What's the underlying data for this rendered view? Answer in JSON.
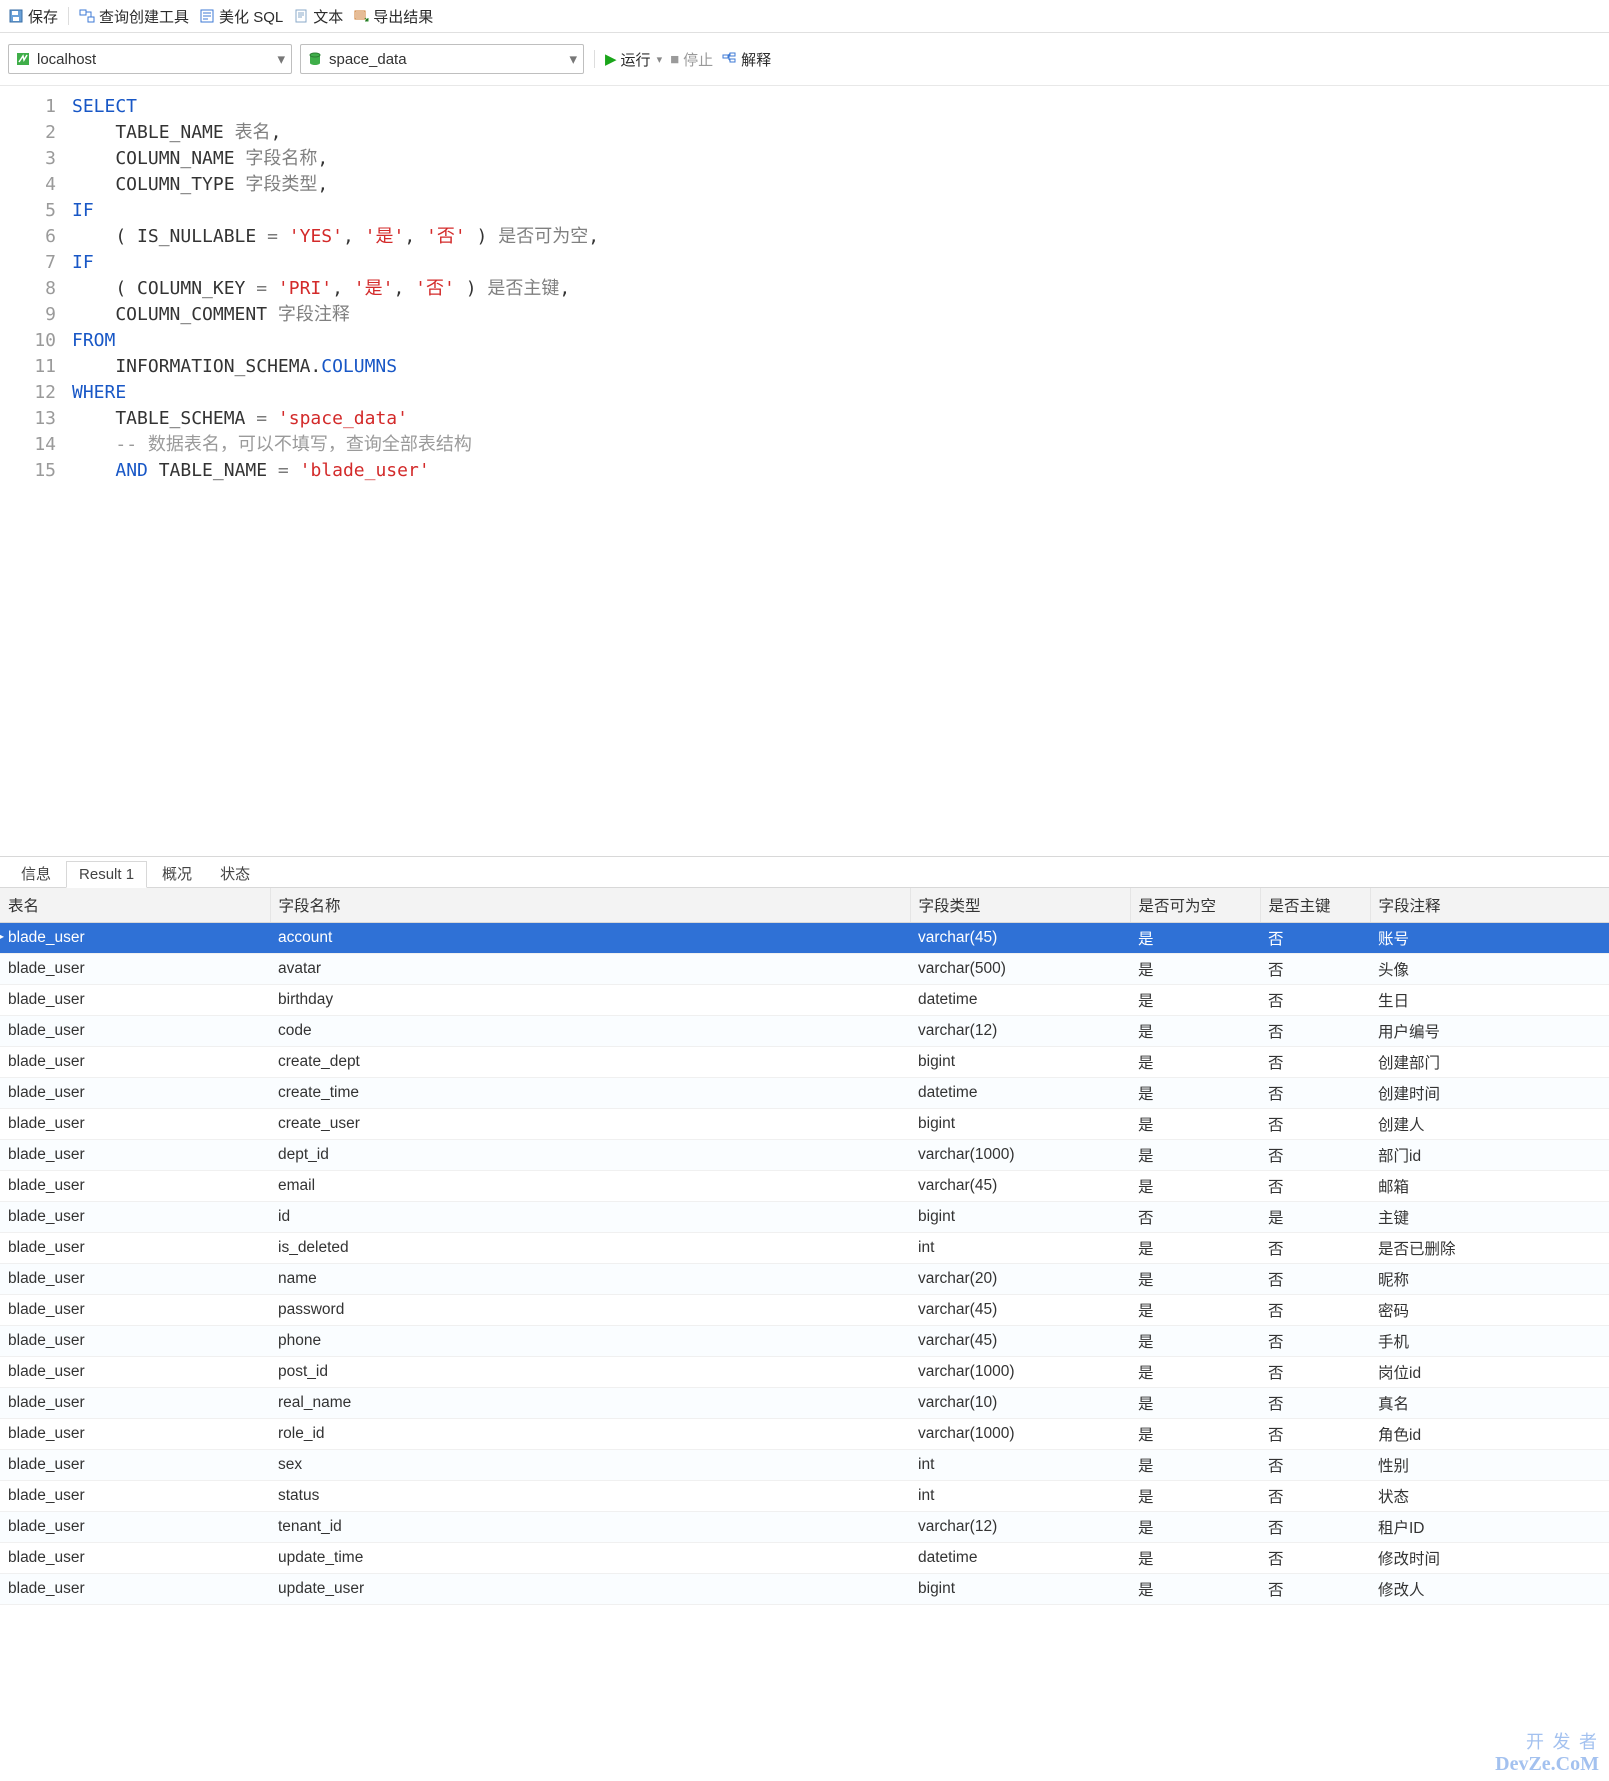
{
  "toolbar": {
    "save": "保存",
    "query_builder": "查询创建工具",
    "beautify": "美化 SQL",
    "text": "文本",
    "export": "导出结果"
  },
  "runbar": {
    "connection": "localhost",
    "database": "space_data",
    "run": "运行",
    "stop": "停止",
    "explain": "解释"
  },
  "code_lines": [
    [
      {
        "t": "SELECT",
        "c": "kw"
      }
    ],
    [
      {
        "t": "    TABLE_NAME "
      },
      {
        "t": "表名",
        "c": "cjk"
      },
      {
        "t": ","
      }
    ],
    [
      {
        "t": "    COLUMN_NAME "
      },
      {
        "t": "字段名称",
        "c": "cjk"
      },
      {
        "t": ","
      }
    ],
    [
      {
        "t": "    COLUMN_TYPE "
      },
      {
        "t": "字段类型",
        "c": "cjk"
      },
      {
        "t": ","
      }
    ],
    [
      {
        "t": "IF",
        "c": "kw"
      }
    ],
    [
      {
        "t": "    ( IS_NULLABLE "
      },
      {
        "t": "=",
        "c": "op"
      },
      {
        "t": " "
      },
      {
        "t": "'YES'",
        "c": "str"
      },
      {
        "t": ", "
      },
      {
        "t": "'是'",
        "c": "str"
      },
      {
        "t": ", "
      },
      {
        "t": "'否'",
        "c": "str"
      },
      {
        "t": " ) "
      },
      {
        "t": "是否可为空",
        "c": "cjk"
      },
      {
        "t": ","
      }
    ],
    [
      {
        "t": "IF",
        "c": "kw"
      }
    ],
    [
      {
        "t": "    ( COLUMN_KEY "
      },
      {
        "t": "=",
        "c": "op"
      },
      {
        "t": " "
      },
      {
        "t": "'PRI'",
        "c": "str"
      },
      {
        "t": ", "
      },
      {
        "t": "'是'",
        "c": "str"
      },
      {
        "t": ", "
      },
      {
        "t": "'否'",
        "c": "str"
      },
      {
        "t": " ) "
      },
      {
        "t": "是否主键",
        "c": "cjk"
      },
      {
        "t": ","
      }
    ],
    [
      {
        "t": "    COLUMN_COMMENT "
      },
      {
        "t": "字段注释",
        "c": "cjk"
      }
    ],
    [
      {
        "t": "FROM",
        "c": "kw"
      }
    ],
    [
      {
        "t": "    INFORMATION_SCHEMA."
      },
      {
        "t": "COLUMNS",
        "c": "col"
      }
    ],
    [
      {
        "t": "WHERE",
        "c": "kw"
      }
    ],
    [
      {
        "t": "    TABLE_SCHEMA "
      },
      {
        "t": "=",
        "c": "op"
      },
      {
        "t": " "
      },
      {
        "t": "'space_data'",
        "c": "str"
      }
    ],
    [
      {
        "t": "    "
      },
      {
        "t": "-- 数据表名，可以不填写，查询全部表结构",
        "c": "cmt"
      }
    ],
    [
      {
        "t": "    "
      },
      {
        "t": "AND",
        "c": "kw"
      },
      {
        "t": " TABLE_NAME "
      },
      {
        "t": "=",
        "c": "op"
      },
      {
        "t": " "
      },
      {
        "t": "'blade_user'",
        "c": "str"
      }
    ]
  ],
  "result_tabs": {
    "info": "信息",
    "result1": "Result 1",
    "profile": "概况",
    "status": "状态"
  },
  "columns": [
    "表名",
    "字段名称",
    "字段类型",
    "是否可为空",
    "是否主键",
    "字段注释"
  ],
  "rows": [
    [
      "blade_user",
      "account",
      "varchar(45)",
      "是",
      "否",
      "账号"
    ],
    [
      "blade_user",
      "avatar",
      "varchar(500)",
      "是",
      "否",
      "头像"
    ],
    [
      "blade_user",
      "birthday",
      "datetime",
      "是",
      "否",
      "生日"
    ],
    [
      "blade_user",
      "code",
      "varchar(12)",
      "是",
      "否",
      "用户编号"
    ],
    [
      "blade_user",
      "create_dept",
      "bigint",
      "是",
      "否",
      "创建部门"
    ],
    [
      "blade_user",
      "create_time",
      "datetime",
      "是",
      "否",
      "创建时间"
    ],
    [
      "blade_user",
      "create_user",
      "bigint",
      "是",
      "否",
      "创建人"
    ],
    [
      "blade_user",
      "dept_id",
      "varchar(1000)",
      "是",
      "否",
      "部门id"
    ],
    [
      "blade_user",
      "email",
      "varchar(45)",
      "是",
      "否",
      "邮箱"
    ],
    [
      "blade_user",
      "id",
      "bigint",
      "否",
      "是",
      "主键"
    ],
    [
      "blade_user",
      "is_deleted",
      "int",
      "是",
      "否",
      "是否已删除"
    ],
    [
      "blade_user",
      "name",
      "varchar(20)",
      "是",
      "否",
      "昵称"
    ],
    [
      "blade_user",
      "password",
      "varchar(45)",
      "是",
      "否",
      "密码"
    ],
    [
      "blade_user",
      "phone",
      "varchar(45)",
      "是",
      "否",
      "手机"
    ],
    [
      "blade_user",
      "post_id",
      "varchar(1000)",
      "是",
      "否",
      "岗位id"
    ],
    [
      "blade_user",
      "real_name",
      "varchar(10)",
      "是",
      "否",
      "真名"
    ],
    [
      "blade_user",
      "role_id",
      "varchar(1000)",
      "是",
      "否",
      "角色id"
    ],
    [
      "blade_user",
      "sex",
      "int",
      "是",
      "否",
      "性别"
    ],
    [
      "blade_user",
      "status",
      "int",
      "是",
      "否",
      "状态"
    ],
    [
      "blade_user",
      "tenant_id",
      "varchar(12)",
      "是",
      "否",
      "租户ID"
    ],
    [
      "blade_user",
      "update_time",
      "datetime",
      "是",
      "否",
      "修改时间"
    ],
    [
      "blade_user",
      "update_user",
      "bigint",
      "是",
      "否",
      "修改人"
    ]
  ],
  "selected_row_index": 0,
  "watermark": {
    "l1": "开 发 者",
    "l2": "DevZe.CoM"
  }
}
